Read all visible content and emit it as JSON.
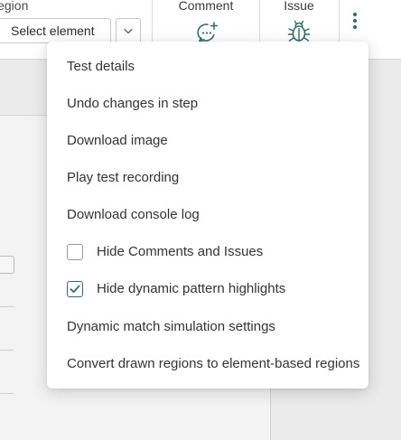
{
  "toolbar": {
    "region_label": "Region",
    "select_value": "Select element",
    "comment_label": "Comment",
    "issue_label": "Issue"
  },
  "menu": {
    "items": [
      {
        "label": "Test details"
      },
      {
        "label": "Undo changes in step"
      },
      {
        "label": "Download image"
      },
      {
        "label": "Play test recording"
      },
      {
        "label": "Download console log"
      },
      {
        "label": "Hide Comments and Issues",
        "checked": false
      },
      {
        "label": "Hide dynamic pattern highlights",
        "checked": true
      },
      {
        "label": "Dynamic match simulation settings"
      },
      {
        "label": "Convert drawn regions to element-based regions"
      }
    ]
  },
  "colors": {
    "accent": "#2e6f73",
    "menu_bg": "#ffffff",
    "page_bg": "#e9e9ea"
  }
}
